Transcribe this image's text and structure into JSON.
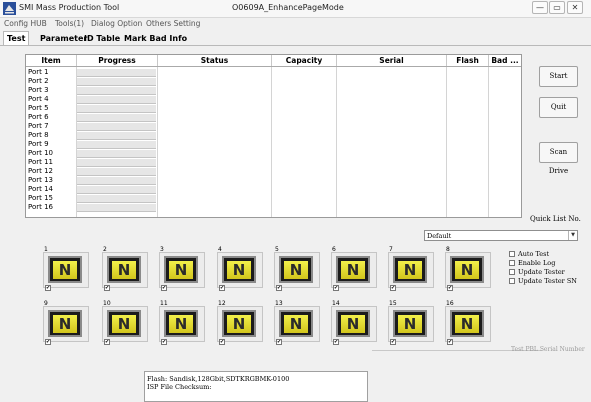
{
  "window": {
    "app_title": "SMI Mass Production Tool",
    "title": "O0609A_EnhancePageMode",
    "min_glyph": "—",
    "max_glyph": "▭",
    "close_glyph": "✕"
  },
  "menu": [
    "Config HUB",
    "Tools(1)",
    "Dialog Option",
    "Others Setting"
  ],
  "tabs": [
    {
      "label": "Test",
      "active": true
    },
    {
      "label": "Parameter",
      "active": false
    },
    {
      "label": "ID Table",
      "active": false
    },
    {
      "label": "Mark Bad Info",
      "active": false
    }
  ],
  "table": {
    "columns": [
      "Item",
      "Progress",
      "Status",
      "Capacity",
      "Serial",
      "Flash",
      "Bad ..."
    ],
    "rows": [
      "Port 1",
      "Port 2",
      "Port 3",
      "Port 4",
      "Port 5",
      "Port 6",
      "Port 7",
      "Port 8",
      "Port 9",
      "Port 10",
      "Port 11",
      "Port 12",
      "Port 13",
      "Port 14",
      "Port 15",
      "Port 16"
    ]
  },
  "buttons": {
    "start": "Start",
    "quit": "Quit",
    "scan": "Scan Drive"
  },
  "quick_list": {
    "label": "Quick List No.",
    "value": "Default"
  },
  "slots": [
    {
      "num": "1",
      "letter": "N",
      "checked": true
    },
    {
      "num": "2",
      "letter": "N",
      "checked": true
    },
    {
      "num": "3",
      "letter": "N",
      "checked": true
    },
    {
      "num": "4",
      "letter": "N",
      "checked": true
    },
    {
      "num": "5",
      "letter": "N",
      "checked": true
    },
    {
      "num": "6",
      "letter": "N",
      "checked": true
    },
    {
      "num": "7",
      "letter": "N",
      "checked": true
    },
    {
      "num": "8",
      "letter": "N",
      "checked": true
    },
    {
      "num": "9",
      "letter": "N",
      "checked": true
    },
    {
      "num": "10",
      "letter": "N",
      "checked": true
    },
    {
      "num": "11",
      "letter": "N",
      "checked": true
    },
    {
      "num": "12",
      "letter": "N",
      "checked": true
    },
    {
      "num": "13",
      "letter": "N",
      "checked": true
    },
    {
      "num": "14",
      "letter": "N",
      "checked": true
    },
    {
      "num": "15",
      "letter": "N",
      "checked": true
    },
    {
      "num": "16",
      "letter": "N",
      "checked": true
    }
  ],
  "options": [
    "Auto Test",
    "Enable Log",
    "Update Tester",
    "Update Tester SN"
  ],
  "hidden_option": "Test PBL Serial Number",
  "log": [
    "Flash: Sandisk,128Gbit,SDTKRGBMK-0100",
    "ISP File Checksum:"
  ],
  "colors": {
    "slot_yellow": "#e8e030",
    "slot_dark": "#1b1b1b"
  }
}
